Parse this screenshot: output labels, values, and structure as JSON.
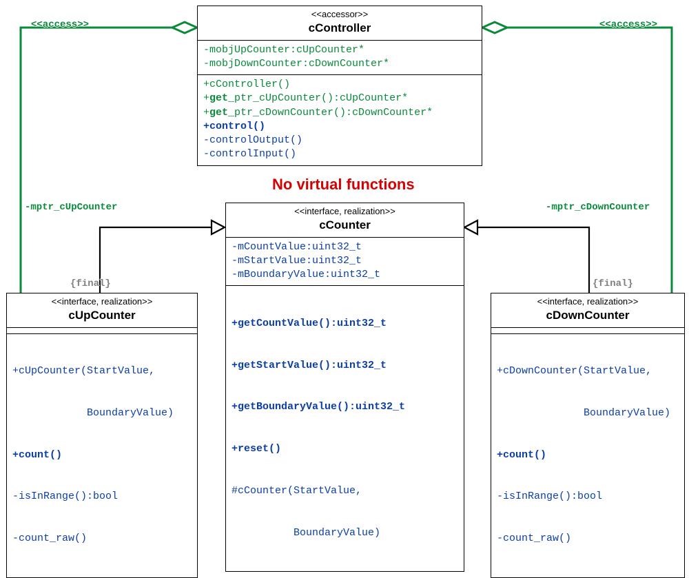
{
  "centerNote": "No virtual functions",
  "labels": {
    "accessLeft": "<<access>>",
    "accessRight": "<<access>>",
    "mptrLeft": "-mptr_cUpCounter",
    "mptrRight": "-mptr_cDownCounter",
    "finalLeft": "{final}",
    "finalRight": "{final}"
  },
  "classes": {
    "controller": {
      "stereotype": "<<accessor>>",
      "name": "cController",
      "attrs": [
        "-mobjUpCounter:cUpCounter*",
        "-mobjDownCounter:cDownCounter*"
      ],
      "ops": {
        "ctor": "+cController()",
        "getUp_pre": "+",
        "getUp_bold": "get",
        "getUp_rest": "_ptr_cUpCounter():cUpCounter*",
        "getDn_pre": "+",
        "getDn_bold": "get",
        "getDn_rest": "_ptr_cDownCounter():cDownCounter*",
        "control": "+control()",
        "ctrlOut": "-controlOutput()",
        "ctrlIn": "-controlInput()"
      }
    },
    "counter": {
      "stereotype": "<<interface, realization>>",
      "name": "cCounter",
      "attrs": [
        "-mCountValue:uint32_t",
        "-mStartValue:uint32_t",
        "-mBoundaryValue:uint32_t"
      ],
      "ops": [
        {
          "text": "+getCountValue():uint32_t",
          "bold": true
        },
        {
          "text": "+getStartValue():uint32_t",
          "bold": true
        },
        {
          "text": "+getBoundaryValue():uint32_t",
          "bold": true
        },
        {
          "text": "+reset()",
          "bold": true
        },
        {
          "text": "#cCounter(StartValue,",
          "bold": false
        },
        {
          "text": "          BoundaryValue)",
          "bold": false
        }
      ]
    },
    "upCounter": {
      "stereotype": "<<interface, realization>>",
      "name": "cUpCounter",
      "ops": [
        {
          "text": "+cUpCounter(StartValue,",
          "bold": false
        },
        {
          "text": "            BoundaryValue)",
          "bold": false
        },
        {
          "text": "+count()",
          "bold": true
        },
        {
          "text": "-isInRange():bool",
          "bold": false
        },
        {
          "text": "-count_raw()",
          "bold": false
        }
      ]
    },
    "downCounter": {
      "stereotype": "<<interface, realization>>",
      "name": "cDownCounter",
      "ops": [
        {
          "text": "+cDownCounter(StartValue,",
          "bold": false
        },
        {
          "text": "              BoundaryValue)",
          "bold": false
        },
        {
          "text": "+count()",
          "bold": true
        },
        {
          "text": "-isInRange():bool",
          "bold": false
        },
        {
          "text": "-count_raw()",
          "bold": false
        }
      ]
    }
  }
}
